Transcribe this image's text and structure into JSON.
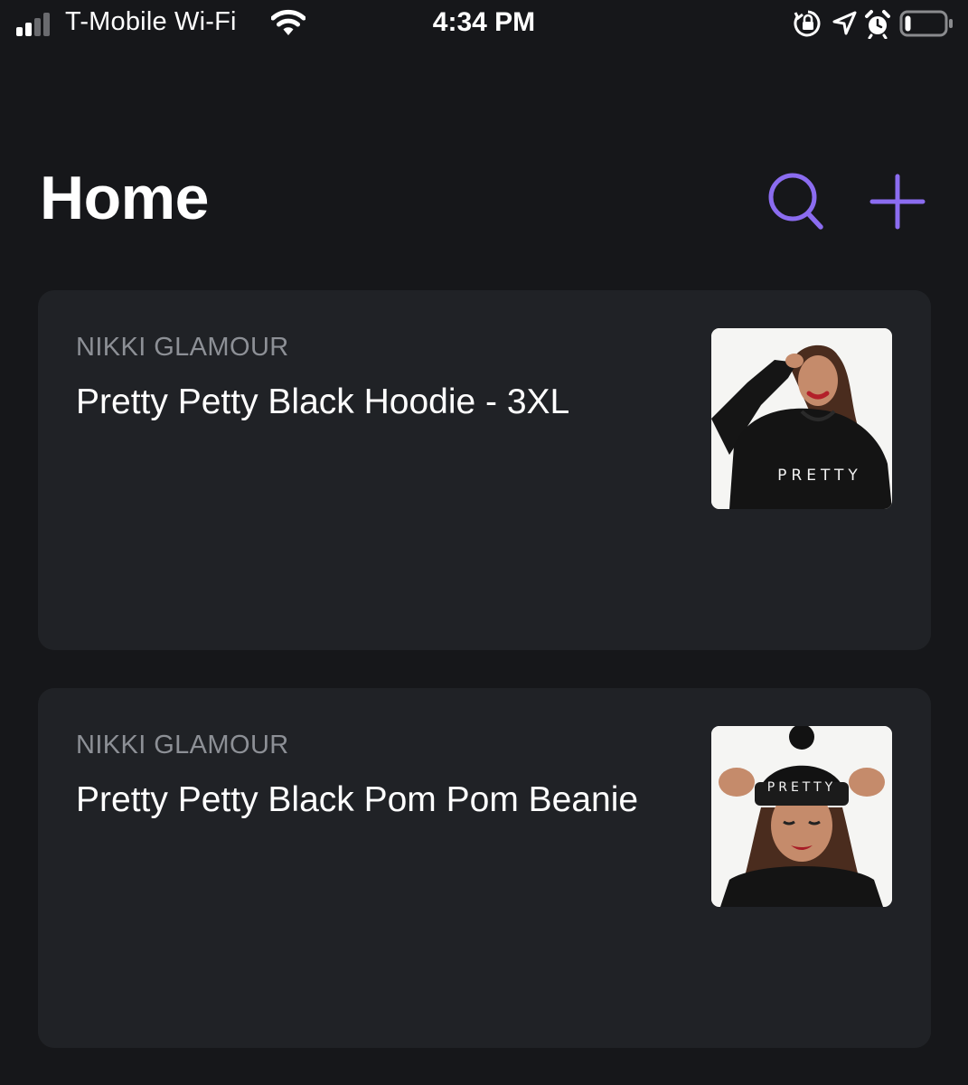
{
  "status_bar": {
    "carrier": "T-Mobile Wi-Fi",
    "time": "4:34 PM",
    "signal_bars_filled": 2,
    "signal_bars_total": 4,
    "icons": [
      "signal-icon",
      "wifi-icon",
      "rotation-lock-icon",
      "location-arrow-icon",
      "alarm-icon",
      "battery-icon"
    ],
    "battery_level": 0.1
  },
  "header": {
    "title": "Home",
    "accent_color": "#8b6cf0",
    "actions": [
      "search-icon",
      "plus-icon"
    ]
  },
  "feed": {
    "items": [
      {
        "seller": "NIKKI GLAMOUR",
        "title": "Pretty Petty Black Hoodie - 3XL",
        "thumbnail_print": "PRETTY"
      },
      {
        "seller": "NIKKI GLAMOUR",
        "title": "Pretty Petty Black Pom Pom Beanie",
        "thumbnail_print": "PRETTY"
      }
    ]
  },
  "colors": {
    "background": "#16171a",
    "card": "#202226",
    "seller_text": "#8d9096",
    "title_text": "#ffffff"
  }
}
